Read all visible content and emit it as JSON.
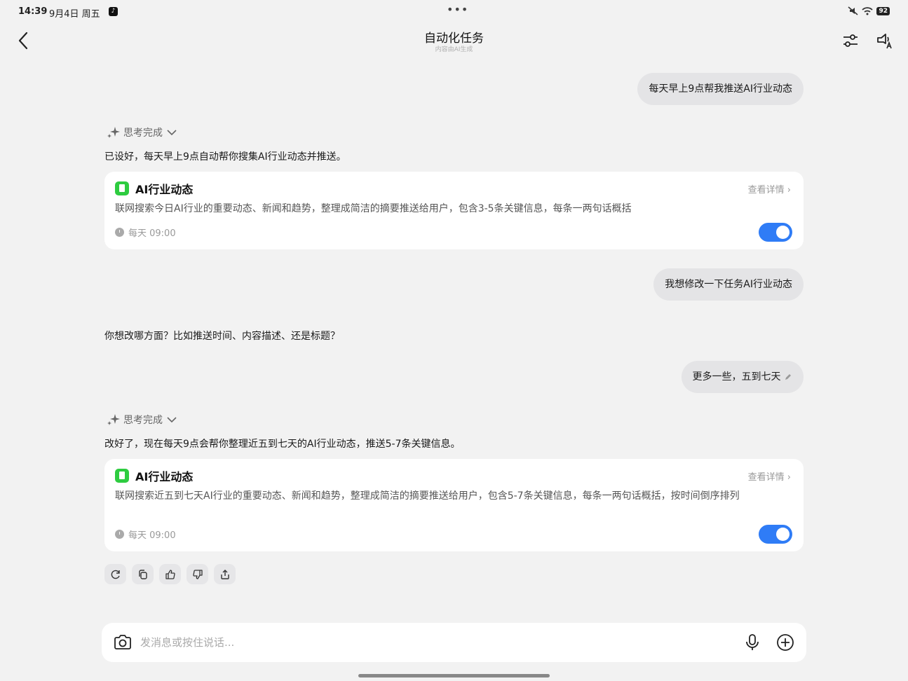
{
  "status_bar": {
    "time": "14:39",
    "date": "9月4日 周五",
    "tiktok_glyph": "♪",
    "dots": "•••",
    "battery": "92"
  },
  "header": {
    "title": "自动化任务",
    "subtitle": "内容由AI生成"
  },
  "messages": {
    "user_1": "每天早上9点帮我推送AI行业动态",
    "thinking_1": "思考完成",
    "ai_1": "已设好，每天早上9点自动帮你搜集AI行业动态并推送。",
    "card_1": {
      "title": "AI行业动态",
      "detail": "查看详情",
      "description": "联网搜索今日AI行业的重要动态、新闻和趋势，整理成简洁的摘要推送给用户，包含3-5条关键信息，每条一两句话概括",
      "schedule": "每天 09:00",
      "enabled": true
    },
    "user_2": "我想修改一下任务AI行业动态",
    "ai_2": "你想改哪方面？比如推送时间、内容描述、还是标题？",
    "user_3": "更多一些，五到七天",
    "thinking_2": "思考完成",
    "ai_3": "改好了，现在每天9点会帮你整理近五到七天的AI行业动态，推送5-7条关键信息。",
    "card_2": {
      "title": "AI行业动态",
      "detail": "查看详情",
      "description": "联网搜索近五到七天AI行业的重要动态、新闻和趋势，整理成简洁的摘要推送给用户，包含5-7条关键信息，每条一两句话概括，按时间倒序排列",
      "schedule": "每天 09:00",
      "enabled": true
    }
  },
  "actions": [
    "refresh-icon",
    "copy-icon",
    "thumbs-up-icon",
    "thumbs-down-icon",
    "share-icon"
  ],
  "input": {
    "placeholder": "发消息或按住说话..."
  },
  "colors": {
    "accent": "#2f7cf6",
    "card_icon": "#2ecc40",
    "background": "#f2f2f2"
  }
}
